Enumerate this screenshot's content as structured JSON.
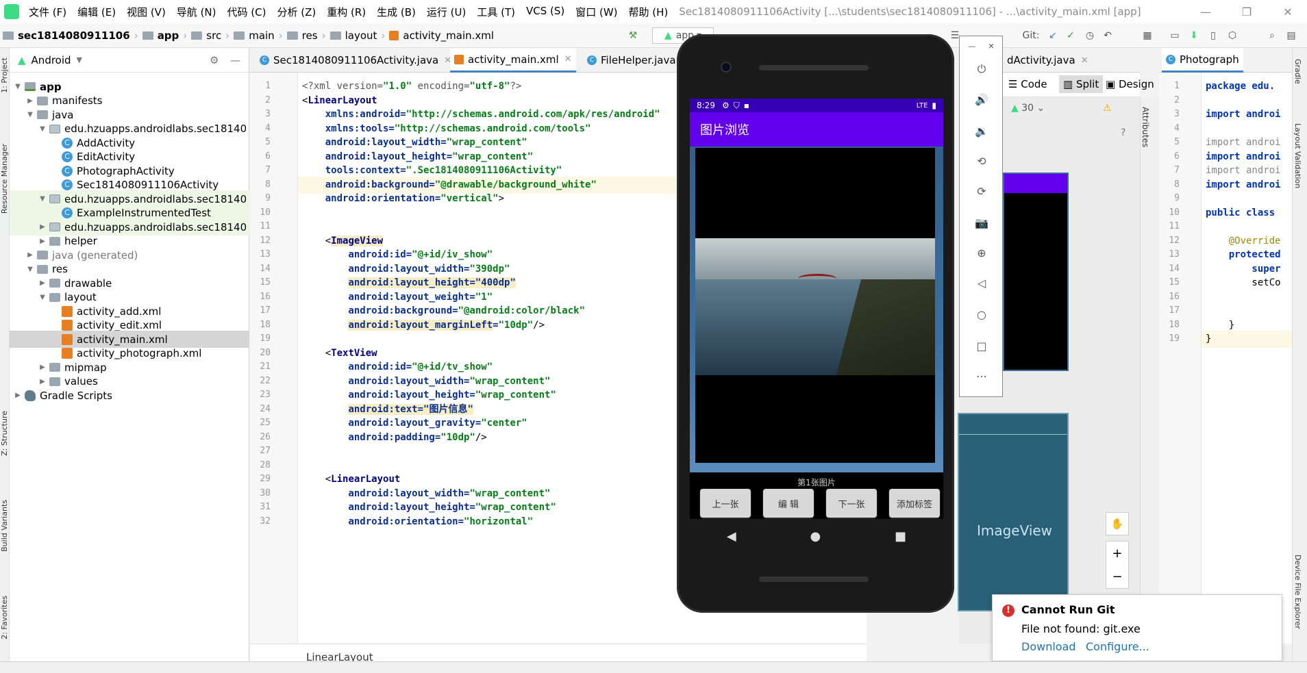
{
  "menu": {
    "items": [
      "文件 (F)",
      "编辑 (E)",
      "视图 (V)",
      "导航 (N)",
      "代码 (C)",
      "分析 (Z)",
      "重构 (R)",
      "生成 (B)",
      "运行 (U)",
      "工具 (T)",
      "VCS (S)",
      "窗口 (W)",
      "帮助 (H)"
    ],
    "window_title": "Sec1814080911106Activity [...\\students\\sec1814080911106] - ...\\activity_main.xml [app]"
  },
  "breadcrumb": {
    "project": "sec1814080911106",
    "module": "app",
    "items": [
      "src",
      "main",
      "res",
      "layout"
    ],
    "file": "activity_main.xml"
  },
  "toolbar": {
    "run_config": "app",
    "git_label": "Git:"
  },
  "project_panel": {
    "view_mode": "Android",
    "tree": [
      {
        "label": "app",
        "indent": 0,
        "arrow": "▼",
        "icon": "app-folder-icon",
        "bold": true
      },
      {
        "label": "manifests",
        "indent": 1,
        "arrow": "▶",
        "icon": "folder-icon"
      },
      {
        "label": "java",
        "indent": 1,
        "arrow": "▼",
        "icon": "folder-icon"
      },
      {
        "label": "edu.hzuapps.androidlabs.sec18140",
        "indent": 2,
        "arrow": "▼",
        "icon": "package-icon"
      },
      {
        "label": "AddActivity",
        "indent": 3,
        "arrow": "",
        "icon": "class-icon"
      },
      {
        "label": "EditActivity",
        "indent": 3,
        "arrow": "",
        "icon": "class-icon"
      },
      {
        "label": "PhotographActivity",
        "indent": 3,
        "arrow": "",
        "icon": "class-icon"
      },
      {
        "label": "Sec1814080911106Activity",
        "indent": 3,
        "arrow": "",
        "icon": "class-icon"
      },
      {
        "label": "edu.hzuapps.androidlabs.sec18140",
        "indent": 2,
        "arrow": "▼",
        "icon": "package-icon",
        "test": true
      },
      {
        "label": "ExampleInstrumentedTest",
        "indent": 3,
        "arrow": "",
        "icon": "class-icon",
        "test": true
      },
      {
        "label": "edu.hzuapps.androidlabs.sec18140",
        "indent": 2,
        "arrow": "▶",
        "icon": "package-icon",
        "test": true
      },
      {
        "label": "helper",
        "indent": 2,
        "arrow": "▶",
        "icon": "folder-icon"
      },
      {
        "label": "java (generated)",
        "indent": 1,
        "arrow": "▶",
        "icon": "folder-icon"
      },
      {
        "label": "res",
        "indent": 1,
        "arrow": "▼",
        "icon": "folder-icon"
      },
      {
        "label": "drawable",
        "indent": 2,
        "arrow": "▶",
        "icon": "folder-icon"
      },
      {
        "label": "layout",
        "indent": 2,
        "arrow": "▼",
        "icon": "folder-icon"
      },
      {
        "label": "activity_add.xml",
        "indent": 3,
        "arrow": "",
        "icon": "xml-icon"
      },
      {
        "label": "activity_edit.xml",
        "indent": 3,
        "arrow": "",
        "icon": "xml-icon"
      },
      {
        "label": "activity_main.xml",
        "indent": 3,
        "arrow": "",
        "icon": "xml-icon",
        "selected": true
      },
      {
        "label": "activity_photograph.xml",
        "indent": 3,
        "arrow": "",
        "icon": "xml-icon"
      },
      {
        "label": "mipmap",
        "indent": 2,
        "arrow": "▶",
        "icon": "folder-icon"
      },
      {
        "label": "values",
        "indent": 2,
        "arrow": "▶",
        "icon": "folder-icon"
      },
      {
        "label": "Gradle Scripts",
        "indent": 0,
        "arrow": "▶",
        "icon": "gradle-icon"
      }
    ]
  },
  "editor_tabs": [
    "Sec1814080911106Activity.java",
    "activity_main.xml",
    "FileHelper.java",
    "dActivity.java"
  ],
  "editor_breadcrumb": "LinearLayout",
  "code_lines": [
    [
      {
        "t": "<?",
        "c": "pi"
      },
      {
        "t": "xml version=",
        "c": "pi"
      },
      {
        "t": "\"1.0\"",
        "c": "str"
      },
      {
        "t": " encoding=",
        "c": "pi"
      },
      {
        "t": "\"utf-8\"",
        "c": "str"
      },
      {
        "t": "?>",
        "c": "pi"
      }
    ],
    [
      {
        "t": "<",
        "c": ""
      },
      {
        "t": "LinearLayout",
        "c": "tag"
      }
    ],
    [
      {
        "t": "    xmlns:android=",
        "c": "attr"
      },
      {
        "t": "\"http://schemas.android.com/apk/res/android\"",
        "c": "str"
      }
    ],
    [
      {
        "t": "    xmlns:tools=",
        "c": "attr"
      },
      {
        "t": "\"http://schemas.android.com/tools\"",
        "c": "str"
      }
    ],
    [
      {
        "t": "    android:layout_width=",
        "c": "attr"
      },
      {
        "t": "\"wrap_content\"",
        "c": "str"
      }
    ],
    [
      {
        "t": "    android:layout_height=",
        "c": "attr"
      },
      {
        "t": "\"wrap_content\"",
        "c": "str"
      }
    ],
    [
      {
        "t": "    tools:context=",
        "c": "attr"
      },
      {
        "t": "\".Sec1814080911106Activity\"",
        "c": "str"
      }
    ],
    [
      {
        "t": "    android:background=",
        "c": "attr"
      },
      {
        "t": "\"@drawable/background_white\"",
        "c": "str"
      }
    ],
    [
      {
        "t": "    android:orientation=",
        "c": "attr"
      },
      {
        "t": "\"vertical\"",
        "c": "str"
      },
      {
        "t": ">",
        "c": ""
      }
    ],
    [],
    [],
    [
      {
        "t": "    <",
        "c": ""
      },
      {
        "t": "ImageView",
        "c": "tag warn"
      }
    ],
    [
      {
        "t": "        android:id=",
        "c": "attr"
      },
      {
        "t": "\"@+id/iv_show\"",
        "c": "str"
      }
    ],
    [
      {
        "t": "        android:layout_width=",
        "c": "attr"
      },
      {
        "t": "\"390dp\"",
        "c": "str"
      }
    ],
    [
      {
        "t": "        ",
        "c": ""
      },
      {
        "t": "android:layout_height=\"400dp\"",
        "c": "attr warn"
      }
    ],
    [
      {
        "t": "        android:layout_weight=",
        "c": "attr"
      },
      {
        "t": "\"1\"",
        "c": "str"
      }
    ],
    [
      {
        "t": "        android:background=",
        "c": "attr"
      },
      {
        "t": "\"@android:color/black\"",
        "c": "str"
      }
    ],
    [
      {
        "t": "        ",
        "c": ""
      },
      {
        "t": "android:layout_marginLeft",
        "c": "attr warn"
      },
      {
        "t": "=",
        "c": "attr"
      },
      {
        "t": "\"10dp\"",
        "c": "str"
      },
      {
        "t": "/>",
        "c": ""
      }
    ],
    [],
    [
      {
        "t": "    <",
        "c": ""
      },
      {
        "t": "TextView",
        "c": "tag"
      }
    ],
    [
      {
        "t": "        android:id=",
        "c": "attr"
      },
      {
        "t": "\"@+id/tv_show\"",
        "c": "str"
      }
    ],
    [
      {
        "t": "        android:layout_width=",
        "c": "attr"
      },
      {
        "t": "\"wrap_content\"",
        "c": "str"
      }
    ],
    [
      {
        "t": "        android:layout_height=",
        "c": "attr"
      },
      {
        "t": "\"wrap_content\"",
        "c": "str"
      }
    ],
    [
      {
        "t": "        ",
        "c": ""
      },
      {
        "t": "android:text=\"图片信息\"",
        "c": "attr warn"
      }
    ],
    [
      {
        "t": "        android:layout_gravity=",
        "c": "attr"
      },
      {
        "t": "\"center\"",
        "c": "str"
      }
    ],
    [
      {
        "t": "        android:padding=",
        "c": "attr"
      },
      {
        "t": "\"10dp\"",
        "c": "str"
      },
      {
        "t": "/>",
        "c": ""
      }
    ],
    [],
    [],
    [
      {
        "t": "    <",
        "c": ""
      },
      {
        "t": "LinearLayout",
        "c": "tag"
      }
    ],
    [
      {
        "t": "        android:layout_width=",
        "c": "attr"
      },
      {
        "t": "\"wrap_content\"",
        "c": "str"
      }
    ],
    [
      {
        "t": "        android:layout_height=",
        "c": "attr"
      },
      {
        "t": "\"wrap_content\"",
        "c": "str"
      }
    ],
    [
      {
        "t": "        android:orientation=",
        "c": "attr"
      },
      {
        "t": "\"horizontal\"",
        "c": "str"
      }
    ]
  ],
  "emulator": {
    "time": "8:29",
    "signal": "LTE",
    "app_title": "图片浏览",
    "caption": "第1张图片",
    "buttons": [
      "上一张",
      "编 辑",
      "下一张",
      "添加标签"
    ]
  },
  "design": {
    "code_label": "Code",
    "split_label": "Split",
    "design_label": "Design",
    "api_level": "30",
    "attributes_label": "Attributes",
    "imageview_label": "ImageView"
  },
  "java_panel": {
    "tab": "Photograph",
    "lines": [
      [
        {
          "t": "package edu.",
          "c": "kw"
        }
      ],
      [],
      [
        {
          "t": "import androi",
          "c": "kw"
        }
      ],
      [],
      [
        {
          "t": "import androi",
          "c": "gray"
        }
      ],
      [
        {
          "t": "import androi",
          "c": "kw"
        }
      ],
      [
        {
          "t": "import androi",
          "c": "gray"
        }
      ],
      [
        {
          "t": "import androi",
          "c": "kw"
        }
      ],
      [],
      [
        {
          "t": "public class ",
          "c": "kw"
        }
      ],
      [],
      [
        {
          "t": "    @Override",
          "c": "ann"
        }
      ],
      [
        {
          "t": "    protected",
          "c": "kw"
        }
      ],
      [
        {
          "t": "        super",
          "c": "kw"
        }
      ],
      [
        {
          "t": "        setCo",
          "c": ""
        }
      ],
      [],
      [],
      [
        {
          "t": "    }",
          "c": ""
        }
      ],
      [
        {
          "t": "}",
          "c": ""
        }
      ]
    ]
  },
  "side_tabs": {
    "left": [
      "1: Project",
      "Resource Manager",
      "Z: Structure",
      "Build Variants",
      "2: Favorites"
    ],
    "right": [
      "Gradle",
      "Layout Validation",
      "Device File Explorer"
    ]
  },
  "notification": {
    "title": "Cannot Run Git",
    "message": "File not found: git.exe",
    "link_download": "Download",
    "link_configure": "Configure..."
  },
  "status_right": "Photograph"
}
